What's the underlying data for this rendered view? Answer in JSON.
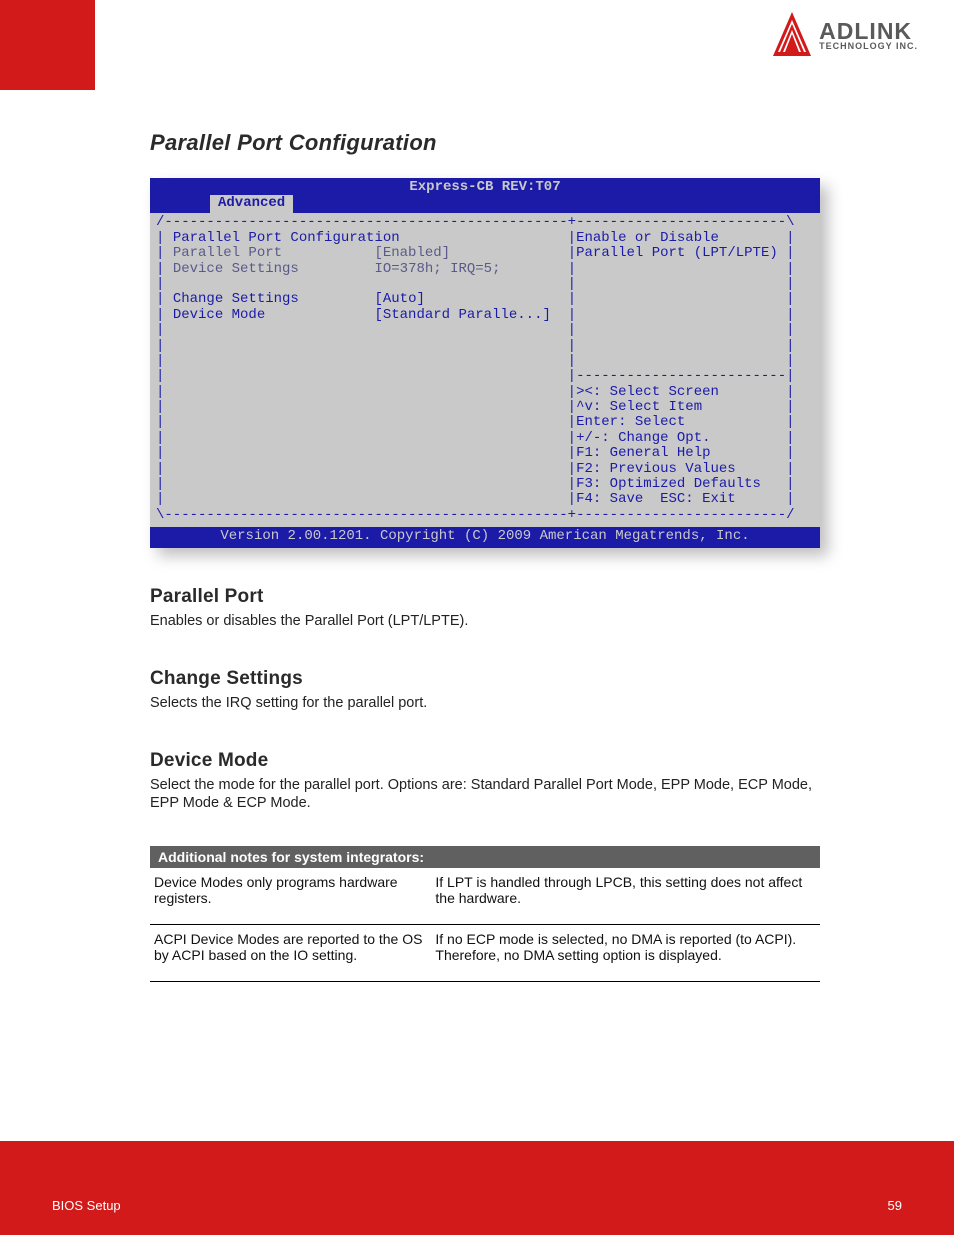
{
  "brand": {
    "name": "ADLINK",
    "tagline": "TECHNOLOGY INC."
  },
  "page": {
    "section_title": "Parallel Port Configuration"
  },
  "bios": {
    "title": "Express-CB REV:T07",
    "tab": "Advanced",
    "heading": "Parallel Port Configuration",
    "row_parallel_label": "Parallel Port",
    "row_parallel_value": "[Enabled]",
    "row_devset_label": "Device Settings",
    "row_devset_value": "IO=378h; IRQ=5;",
    "row_change_label": "Change Settings",
    "row_change_value": "[Auto]",
    "row_mode_label": "Device Mode",
    "row_mode_value": "[Standard Paralle...]",
    "help1": "Enable or Disable",
    "help2": "Parallel Port (LPT/LPTE)",
    "nav1": "><: Select Screen",
    "nav2": "^v: Select Item",
    "nav3": "Enter: Select",
    "nav4": "+/-: Change Opt.",
    "nav5": "F1: General Help",
    "nav6": "F2: Previous Values",
    "nav7": "F3: Optimized Defaults",
    "nav8": "F4: Save  ESC: Exit",
    "footer": "Version 2.00.1201. Copyright (C) 2009 American Megatrends, Inc."
  },
  "parallel_port": {
    "title": "Parallel Port",
    "body": "Enables or disables the Parallel Port (LPT/LPTE)."
  },
  "change_settings": {
    "title": "Change Settings",
    "body": "Selects the IRQ setting for the parallel port."
  },
  "device_mode": {
    "title": "Device Mode",
    "body": "Select the mode for the parallel port. Options are: Standard Parallel Port Mode, EPP Mode, ECP Mode, EPP Mode & ECP Mode."
  },
  "notes": {
    "head": "Additional notes for system integrators:",
    "r1a": "Device Modes only programs hardware registers.",
    "r1b": "If LPT is handled through LPCB, this setting does not affect the hardware.",
    "r2a": "ACPI Device Modes are reported to the OS by ACPI based on the IO setting.",
    "r2b": "If no ECP mode is selected, no DMA is reported (to ACPI). Therefore, no DMA setting option is displayed."
  },
  "footer": {
    "left": "BIOS Setup",
    "right": "59"
  }
}
